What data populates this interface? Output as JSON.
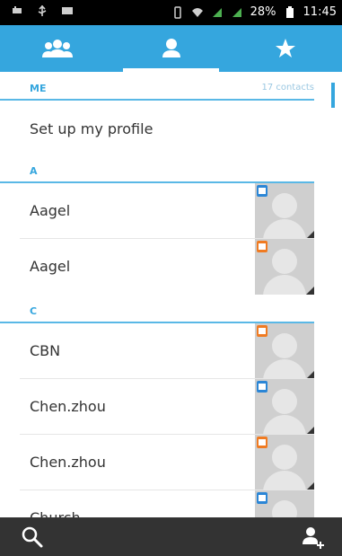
{
  "status_bar": {
    "battery_percent": "28%",
    "time": "11:45",
    "icons": [
      "notification-icon",
      "usb-icon",
      "image-icon",
      "vibrate-icon",
      "wifi-icon",
      "signal-icon",
      "signal-icon",
      "battery-icon"
    ]
  },
  "tabs": [
    {
      "name": "groups",
      "icon": "groups-icon",
      "active": false
    },
    {
      "name": "contacts",
      "icon": "person-icon",
      "active": true
    },
    {
      "name": "favorites",
      "icon": "star-icon",
      "active": false
    }
  ],
  "me_section": {
    "header": "ME",
    "count": "17 contacts",
    "profile_label": "Set up my profile"
  },
  "sections": [
    {
      "letter": "A",
      "contacts": [
        {
          "name": "Aagel",
          "account_color": "#2b86d6"
        },
        {
          "name": "Aagel",
          "account_color": "#f07b22"
        }
      ]
    },
    {
      "letter": "C",
      "contacts": [
        {
          "name": "CBN",
          "account_color": "#f07b22"
        },
        {
          "name": "Chen.zhou",
          "account_color": "#2b86d6"
        },
        {
          "name": "Chen.zhou",
          "account_color": "#f07b22"
        },
        {
          "name": "Church",
          "account_color": "#2b86d6"
        }
      ]
    }
  ],
  "bottom_bar": {
    "search_icon": "search-icon",
    "add_contact_icon": "add-contact-icon"
  },
  "colors": {
    "accent": "#35a6de",
    "bottom_bar": "#333333",
    "orange_account": "#f07b22",
    "blue_account": "#2b86d6"
  }
}
